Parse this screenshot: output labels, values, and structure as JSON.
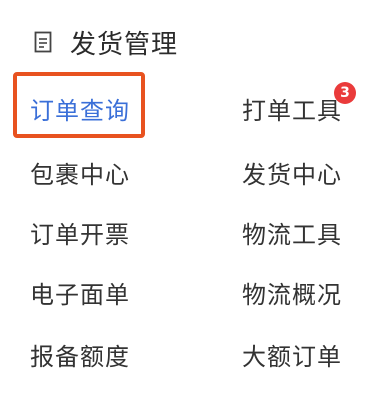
{
  "header": {
    "icon": "document-icon",
    "title": "发货管理"
  },
  "menu": {
    "items": [
      {
        "label": "订单查询",
        "active": true
      },
      {
        "label": "打单工具",
        "badge": "3"
      },
      {
        "label": "包裹中心"
      },
      {
        "label": "发货中心"
      },
      {
        "label": "订单开票"
      },
      {
        "label": "物流工具"
      },
      {
        "label": "电子面单"
      },
      {
        "label": "物流概况"
      },
      {
        "label": "报备额度"
      },
      {
        "label": "大额订单"
      }
    ]
  },
  "colors": {
    "active_text": "#3a6fd8",
    "highlight_border": "#e8521f",
    "badge_bg": "#ea3b3b",
    "text": "#333333"
  }
}
